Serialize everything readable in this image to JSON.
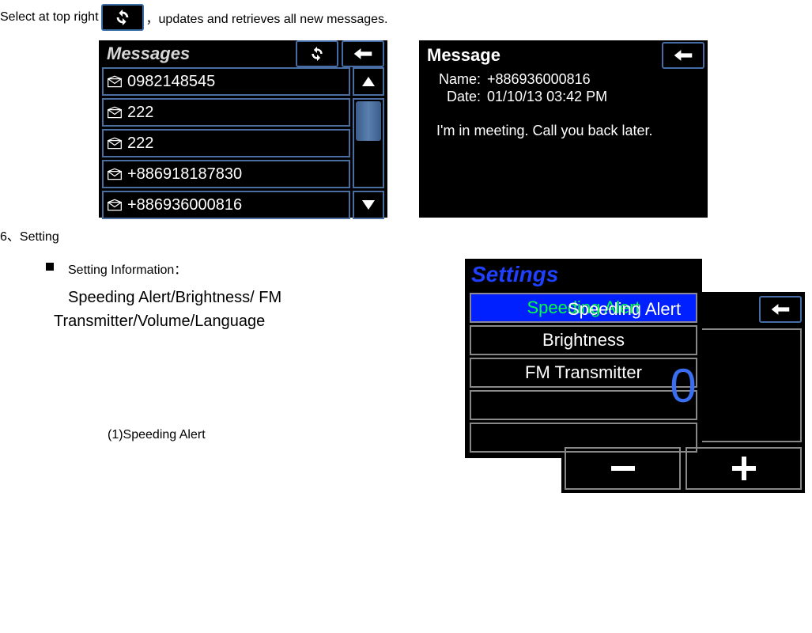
{
  "intro": {
    "before": "Select at top right",
    "after": "，updates and retrieves all new messages."
  },
  "messages_screen": {
    "title": "Messages",
    "items": [
      "0982148545",
      "222",
      "222",
      "+886918187830",
      "+886936000816"
    ]
  },
  "detail_screen": {
    "title": "Message",
    "name_label": "Name:",
    "date_label": "Date:",
    "name_value": "+886936000816",
    "date_value": "01/10/13 03:42 PM",
    "body": "I'm in meeting. Call you back later."
  },
  "section6": "6、Setting",
  "setting_info_label": "Setting Information：",
  "setting_options_line1": "Speeding Alert/Brightness/ FM",
  "setting_options_line2": "Transmitter/Volume/Language",
  "settings_screen": {
    "title": "Settings",
    "items": [
      "Speeding Alert",
      "Brightness",
      "FM Transmitter",
      "",
      ""
    ]
  },
  "subsection_label": "(1)Speeding Alert",
  "speeding_screen": {
    "title": "Speeding Alert",
    "value": "0"
  }
}
